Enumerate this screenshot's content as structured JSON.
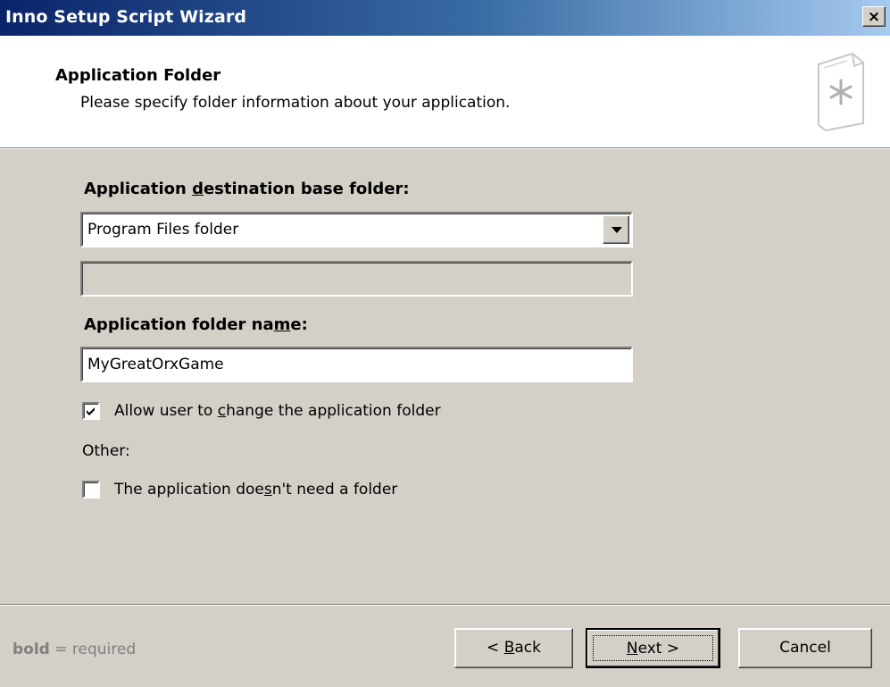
{
  "window": {
    "title": "Inno Setup Script Wizard",
    "close_glyph": "×",
    "close_icon": "close-icon"
  },
  "header": {
    "title": "Application Folder",
    "subtitle": "Please specify folder information about your application.",
    "icon": "wizard-page-icon"
  },
  "form": {
    "dest_label_pre": "Application ",
    "dest_label_key": "d",
    "dest_label_post": "estination base folder:",
    "dest_value": "Program Files folder",
    "custom_folder_value": "",
    "folder_name_label_pre": "Application folder na",
    "folder_name_label_key": "m",
    "folder_name_label_post": "e:",
    "folder_name_value": "MyGreatOrxGame",
    "allow_change_pre": "Allow user to ",
    "allow_change_key": "c",
    "allow_change_post": "hange the application folder",
    "allow_change_checked": true,
    "other_label": "Other:",
    "no_folder_pre": "The application doe",
    "no_folder_key": "s",
    "no_folder_post": "n't need a folder",
    "no_folder_checked": false
  },
  "footer": {
    "note_bold": "bold",
    "note_rest": " = required",
    "back_pre": "< ",
    "back_key": "B",
    "back_post": "ack",
    "next_key": "N",
    "next_post": "ext >",
    "cancel": "Cancel"
  },
  "colors": {
    "titlebar_start": "#0a246a",
    "titlebar_end": "#a6caf0",
    "face": "#d4d0c8",
    "disabled_text": "#808080"
  }
}
